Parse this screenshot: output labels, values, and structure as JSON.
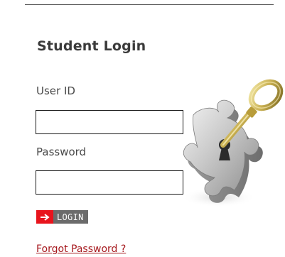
{
  "login": {
    "title": "Student Login",
    "user_id_label": "User ID",
    "user_id_value": "",
    "password_label": "Password",
    "password_value": "",
    "button_label": "LOGIN",
    "forgot_link": "Forgot Password ?"
  },
  "illustration": {
    "icon": "puzzle-key-icon"
  },
  "colors": {
    "title": "#3b3b3b",
    "label": "#4a4a4a",
    "button_arrow": "#e8141c",
    "button_text_bg": "#6b6b6b",
    "link": "#a6191e"
  }
}
